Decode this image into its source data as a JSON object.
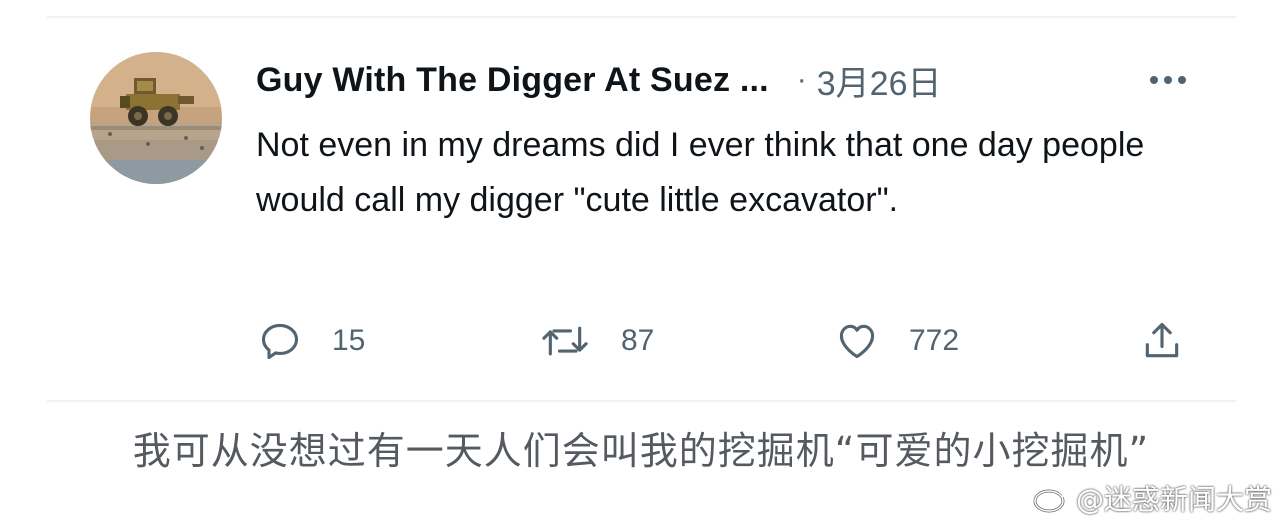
{
  "tweet": {
    "author_name": "Guy With The Digger At Suez ...",
    "separator": "·",
    "date": "3月26日",
    "text": "Not even in my dreams did I ever think that one day people would call my digger \"cute little excavator\".",
    "avatar_icon": "excavator-avatar",
    "more_icon": "more-dots-icon"
  },
  "actions": {
    "reply": {
      "icon": "reply-icon",
      "count": "15"
    },
    "retweet": {
      "icon": "retweet-icon",
      "count": "87"
    },
    "like": {
      "icon": "heart-icon",
      "count": "772"
    },
    "share": {
      "icon": "share-icon"
    }
  },
  "caption": {
    "text": "我可从没想过有一天人们会叫我的挖掘机“可爱的小挖掘机”"
  },
  "watermark": {
    "text": "@迷惑新闻大赏",
    "icon": "weibo-logo-icon"
  },
  "colors": {
    "text_primary": "#0f1419",
    "text_secondary": "#536471",
    "divider": "#eff1f3",
    "caption": "#555a60"
  }
}
